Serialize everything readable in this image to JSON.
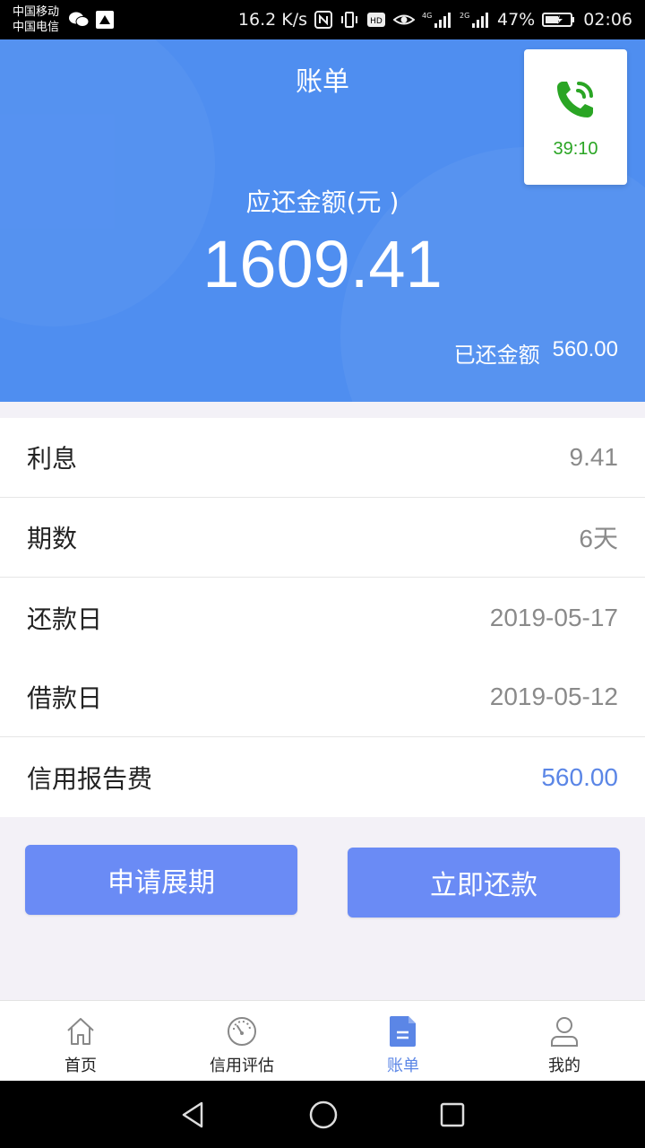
{
  "status_bar": {
    "carrier_1": "中国移动",
    "carrier_2": "中国电信",
    "speed": "16.2 K/s",
    "battery": "47%",
    "time": "02:06"
  },
  "header": {
    "title": "账单",
    "amount_label": "应还金额(元 )",
    "amount": "1609.41",
    "paid_label": "已还金额",
    "paid_value": "560.00"
  },
  "call_widget": {
    "duration": "39:10",
    "color": "#2aa524"
  },
  "details": [
    {
      "label": "利息",
      "value": "9.41"
    },
    {
      "label": "期数",
      "value": "6天"
    },
    {
      "label": "还款日",
      "value": "2019-05-17"
    },
    {
      "label": "借款日",
      "value": "2019-05-12"
    },
    {
      "label": "信用报告费",
      "value": "560.00"
    }
  ],
  "actions": {
    "extend_label": "申请展期",
    "repay_label": "立即还款"
  },
  "tabs": [
    {
      "label": "首页",
      "icon": "home-icon"
    },
    {
      "label": "信用评估",
      "icon": "gauge-icon"
    },
    {
      "label": "账单",
      "icon": "bill-icon",
      "active": true
    },
    {
      "label": "我的",
      "icon": "user-icon"
    }
  ],
  "colors": {
    "header_bg": "#4f8ef0",
    "button_bg": "#6a8bf5",
    "accent": "#5b86e6"
  }
}
